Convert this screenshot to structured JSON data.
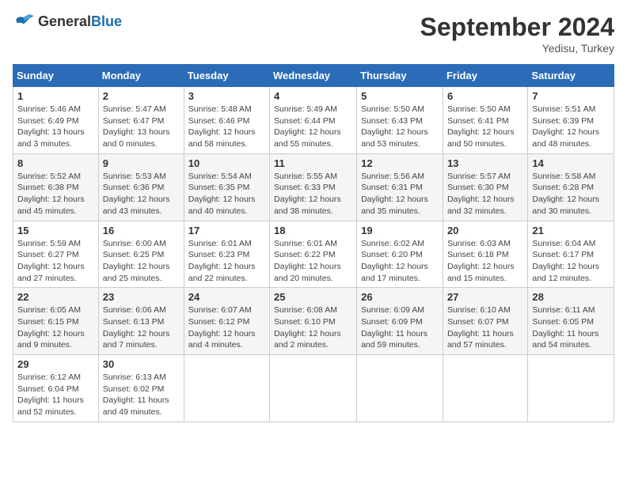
{
  "header": {
    "logo_general": "General",
    "logo_blue": "Blue",
    "month_title": "September 2024",
    "location": "Yedisu, Turkey"
  },
  "days_of_week": [
    "Sunday",
    "Monday",
    "Tuesday",
    "Wednesday",
    "Thursday",
    "Friday",
    "Saturday"
  ],
  "weeks": [
    [
      {
        "day": "1",
        "info": "Sunrise: 5:46 AM\nSunset: 6:49 PM\nDaylight: 13 hours\nand 3 minutes."
      },
      {
        "day": "2",
        "info": "Sunrise: 5:47 AM\nSunset: 6:47 PM\nDaylight: 13 hours\nand 0 minutes."
      },
      {
        "day": "3",
        "info": "Sunrise: 5:48 AM\nSunset: 6:46 PM\nDaylight: 12 hours\nand 58 minutes."
      },
      {
        "day": "4",
        "info": "Sunrise: 5:49 AM\nSunset: 6:44 PM\nDaylight: 12 hours\nand 55 minutes."
      },
      {
        "day": "5",
        "info": "Sunrise: 5:50 AM\nSunset: 6:43 PM\nDaylight: 12 hours\nand 53 minutes."
      },
      {
        "day": "6",
        "info": "Sunrise: 5:50 AM\nSunset: 6:41 PM\nDaylight: 12 hours\nand 50 minutes."
      },
      {
        "day": "7",
        "info": "Sunrise: 5:51 AM\nSunset: 6:39 PM\nDaylight: 12 hours\nand 48 minutes."
      }
    ],
    [
      {
        "day": "8",
        "info": "Sunrise: 5:52 AM\nSunset: 6:38 PM\nDaylight: 12 hours\nand 45 minutes."
      },
      {
        "day": "9",
        "info": "Sunrise: 5:53 AM\nSunset: 6:36 PM\nDaylight: 12 hours\nand 43 minutes."
      },
      {
        "day": "10",
        "info": "Sunrise: 5:54 AM\nSunset: 6:35 PM\nDaylight: 12 hours\nand 40 minutes."
      },
      {
        "day": "11",
        "info": "Sunrise: 5:55 AM\nSunset: 6:33 PM\nDaylight: 12 hours\nand 38 minutes."
      },
      {
        "day": "12",
        "info": "Sunrise: 5:56 AM\nSunset: 6:31 PM\nDaylight: 12 hours\nand 35 minutes."
      },
      {
        "day": "13",
        "info": "Sunrise: 5:57 AM\nSunset: 6:30 PM\nDaylight: 12 hours\nand 32 minutes."
      },
      {
        "day": "14",
        "info": "Sunrise: 5:58 AM\nSunset: 6:28 PM\nDaylight: 12 hours\nand 30 minutes."
      }
    ],
    [
      {
        "day": "15",
        "info": "Sunrise: 5:59 AM\nSunset: 6:27 PM\nDaylight: 12 hours\nand 27 minutes."
      },
      {
        "day": "16",
        "info": "Sunrise: 6:00 AM\nSunset: 6:25 PM\nDaylight: 12 hours\nand 25 minutes."
      },
      {
        "day": "17",
        "info": "Sunrise: 6:01 AM\nSunset: 6:23 PM\nDaylight: 12 hours\nand 22 minutes."
      },
      {
        "day": "18",
        "info": "Sunrise: 6:01 AM\nSunset: 6:22 PM\nDaylight: 12 hours\nand 20 minutes."
      },
      {
        "day": "19",
        "info": "Sunrise: 6:02 AM\nSunset: 6:20 PM\nDaylight: 12 hours\nand 17 minutes."
      },
      {
        "day": "20",
        "info": "Sunrise: 6:03 AM\nSunset: 6:18 PM\nDaylight: 12 hours\nand 15 minutes."
      },
      {
        "day": "21",
        "info": "Sunrise: 6:04 AM\nSunset: 6:17 PM\nDaylight: 12 hours\nand 12 minutes."
      }
    ],
    [
      {
        "day": "22",
        "info": "Sunrise: 6:05 AM\nSunset: 6:15 PM\nDaylight: 12 hours\nand 9 minutes."
      },
      {
        "day": "23",
        "info": "Sunrise: 6:06 AM\nSunset: 6:13 PM\nDaylight: 12 hours\nand 7 minutes."
      },
      {
        "day": "24",
        "info": "Sunrise: 6:07 AM\nSunset: 6:12 PM\nDaylight: 12 hours\nand 4 minutes."
      },
      {
        "day": "25",
        "info": "Sunrise: 6:08 AM\nSunset: 6:10 PM\nDaylight: 12 hours\nand 2 minutes."
      },
      {
        "day": "26",
        "info": "Sunrise: 6:09 AM\nSunset: 6:09 PM\nDaylight: 11 hours\nand 59 minutes."
      },
      {
        "day": "27",
        "info": "Sunrise: 6:10 AM\nSunset: 6:07 PM\nDaylight: 11 hours\nand 57 minutes."
      },
      {
        "day": "28",
        "info": "Sunrise: 6:11 AM\nSunset: 6:05 PM\nDaylight: 11 hours\nand 54 minutes."
      }
    ],
    [
      {
        "day": "29",
        "info": "Sunrise: 6:12 AM\nSunset: 6:04 PM\nDaylight: 11 hours\nand 52 minutes."
      },
      {
        "day": "30",
        "info": "Sunrise: 6:13 AM\nSunset: 6:02 PM\nDaylight: 11 hours\nand 49 minutes."
      },
      null,
      null,
      null,
      null,
      null
    ]
  ]
}
